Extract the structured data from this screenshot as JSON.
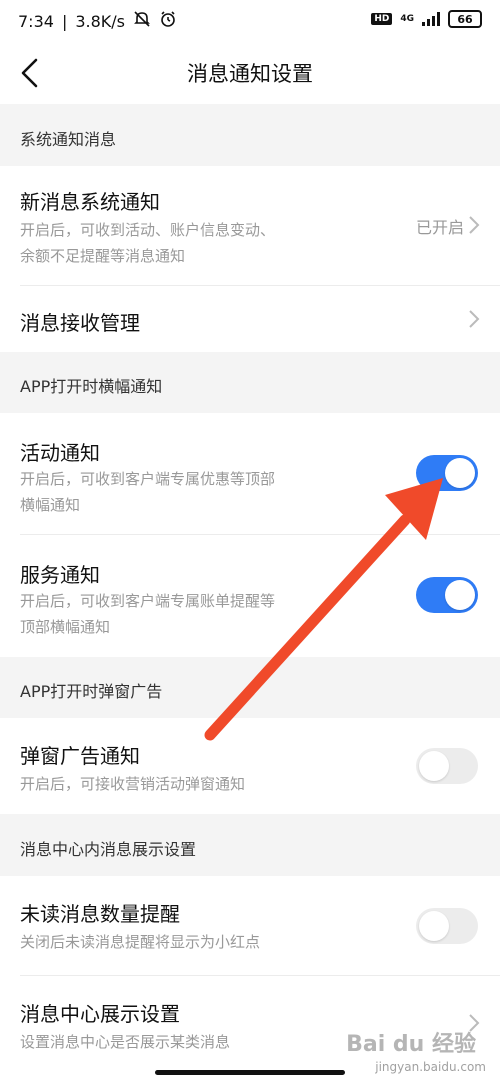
{
  "statusbar": {
    "time": "7:34",
    "speed": "3.8K/s",
    "network": "4G",
    "hd": "HD",
    "battery": "66"
  },
  "navbar": {
    "title": "消息通知设置"
  },
  "sections": {
    "system": "系统通知消息",
    "banner": "APP打开时横幅通知",
    "popup": "APP打开时弹窗广告",
    "center": "消息中心内消息展示设置"
  },
  "rows": {
    "new_msg": {
      "title": "新消息系统通知",
      "desc_line1": "开启后，可收到活动、账户信息变动、",
      "desc_line2": "余额不足提醒等消息通知",
      "status": "已开启"
    },
    "receive_mgmt": {
      "title": "消息接收管理"
    },
    "activity": {
      "title": "活动通知",
      "desc_line1": "开启后，可收到客户端专属优惠等顶部",
      "desc_line2": "横幅通知",
      "enabled": true
    },
    "service": {
      "title": "服务通知",
      "desc_line1": "开启后，可收到客户端专属账单提醒等",
      "desc_line2": "顶部横幅通知",
      "enabled": true
    },
    "popup_ad": {
      "title": "弹窗广告通知",
      "desc_line1": "开启后，可接收营销活动弹窗通知",
      "enabled": false
    },
    "unread": {
      "title": "未读消息数量提醒",
      "desc_line1": "关闭后未读消息提醒将显示为小红点",
      "enabled": false
    },
    "center_display": {
      "title": "消息中心展示设置",
      "desc_line1": "设置消息中心是否展示某类消息"
    }
  },
  "watermark": {
    "logo": "Bai du 经验",
    "url": "jingyan.baidu.com"
  },
  "colors": {
    "toggle_on": "#2f7cf6",
    "toggle_off": "#ececec",
    "annotation_arrow": "#f04a2a"
  }
}
